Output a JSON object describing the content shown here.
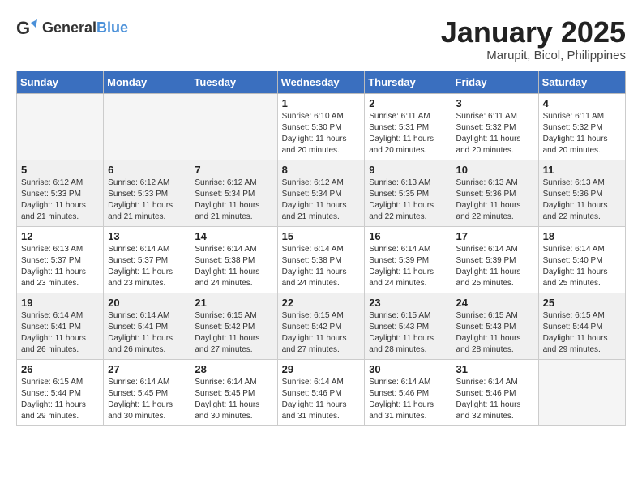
{
  "header": {
    "logo_general": "General",
    "logo_blue": "Blue",
    "month_title": "January 2025",
    "location": "Marupit, Bicol, Philippines"
  },
  "weekdays": [
    "Sunday",
    "Monday",
    "Tuesday",
    "Wednesday",
    "Thursday",
    "Friday",
    "Saturday"
  ],
  "weeks": [
    [
      {
        "day": "",
        "info": ""
      },
      {
        "day": "",
        "info": ""
      },
      {
        "day": "",
        "info": ""
      },
      {
        "day": "1",
        "info": "Sunrise: 6:10 AM\nSunset: 5:30 PM\nDaylight: 11 hours\nand 20 minutes."
      },
      {
        "day": "2",
        "info": "Sunrise: 6:11 AM\nSunset: 5:31 PM\nDaylight: 11 hours\nand 20 minutes."
      },
      {
        "day": "3",
        "info": "Sunrise: 6:11 AM\nSunset: 5:32 PM\nDaylight: 11 hours\nand 20 minutes."
      },
      {
        "day": "4",
        "info": "Sunrise: 6:11 AM\nSunset: 5:32 PM\nDaylight: 11 hours\nand 20 minutes."
      }
    ],
    [
      {
        "day": "5",
        "info": "Sunrise: 6:12 AM\nSunset: 5:33 PM\nDaylight: 11 hours\nand 21 minutes."
      },
      {
        "day": "6",
        "info": "Sunrise: 6:12 AM\nSunset: 5:33 PM\nDaylight: 11 hours\nand 21 minutes."
      },
      {
        "day": "7",
        "info": "Sunrise: 6:12 AM\nSunset: 5:34 PM\nDaylight: 11 hours\nand 21 minutes."
      },
      {
        "day": "8",
        "info": "Sunrise: 6:12 AM\nSunset: 5:34 PM\nDaylight: 11 hours\nand 21 minutes."
      },
      {
        "day": "9",
        "info": "Sunrise: 6:13 AM\nSunset: 5:35 PM\nDaylight: 11 hours\nand 22 minutes."
      },
      {
        "day": "10",
        "info": "Sunrise: 6:13 AM\nSunset: 5:36 PM\nDaylight: 11 hours\nand 22 minutes."
      },
      {
        "day": "11",
        "info": "Sunrise: 6:13 AM\nSunset: 5:36 PM\nDaylight: 11 hours\nand 22 minutes."
      }
    ],
    [
      {
        "day": "12",
        "info": "Sunrise: 6:13 AM\nSunset: 5:37 PM\nDaylight: 11 hours\nand 23 minutes."
      },
      {
        "day": "13",
        "info": "Sunrise: 6:14 AM\nSunset: 5:37 PM\nDaylight: 11 hours\nand 23 minutes."
      },
      {
        "day": "14",
        "info": "Sunrise: 6:14 AM\nSunset: 5:38 PM\nDaylight: 11 hours\nand 24 minutes."
      },
      {
        "day": "15",
        "info": "Sunrise: 6:14 AM\nSunset: 5:38 PM\nDaylight: 11 hours\nand 24 minutes."
      },
      {
        "day": "16",
        "info": "Sunrise: 6:14 AM\nSunset: 5:39 PM\nDaylight: 11 hours\nand 24 minutes."
      },
      {
        "day": "17",
        "info": "Sunrise: 6:14 AM\nSunset: 5:39 PM\nDaylight: 11 hours\nand 25 minutes."
      },
      {
        "day": "18",
        "info": "Sunrise: 6:14 AM\nSunset: 5:40 PM\nDaylight: 11 hours\nand 25 minutes."
      }
    ],
    [
      {
        "day": "19",
        "info": "Sunrise: 6:14 AM\nSunset: 5:41 PM\nDaylight: 11 hours\nand 26 minutes."
      },
      {
        "day": "20",
        "info": "Sunrise: 6:14 AM\nSunset: 5:41 PM\nDaylight: 11 hours\nand 26 minutes."
      },
      {
        "day": "21",
        "info": "Sunrise: 6:15 AM\nSunset: 5:42 PM\nDaylight: 11 hours\nand 27 minutes."
      },
      {
        "day": "22",
        "info": "Sunrise: 6:15 AM\nSunset: 5:42 PM\nDaylight: 11 hours\nand 27 minutes."
      },
      {
        "day": "23",
        "info": "Sunrise: 6:15 AM\nSunset: 5:43 PM\nDaylight: 11 hours\nand 28 minutes."
      },
      {
        "day": "24",
        "info": "Sunrise: 6:15 AM\nSunset: 5:43 PM\nDaylight: 11 hours\nand 28 minutes."
      },
      {
        "day": "25",
        "info": "Sunrise: 6:15 AM\nSunset: 5:44 PM\nDaylight: 11 hours\nand 29 minutes."
      }
    ],
    [
      {
        "day": "26",
        "info": "Sunrise: 6:15 AM\nSunset: 5:44 PM\nDaylight: 11 hours\nand 29 minutes."
      },
      {
        "day": "27",
        "info": "Sunrise: 6:14 AM\nSunset: 5:45 PM\nDaylight: 11 hours\nand 30 minutes."
      },
      {
        "day": "28",
        "info": "Sunrise: 6:14 AM\nSunset: 5:45 PM\nDaylight: 11 hours\nand 30 minutes."
      },
      {
        "day": "29",
        "info": "Sunrise: 6:14 AM\nSunset: 5:46 PM\nDaylight: 11 hours\nand 31 minutes."
      },
      {
        "day": "30",
        "info": "Sunrise: 6:14 AM\nSunset: 5:46 PM\nDaylight: 11 hours\nand 31 minutes."
      },
      {
        "day": "31",
        "info": "Sunrise: 6:14 AM\nSunset: 5:46 PM\nDaylight: 11 hours\nand 32 minutes."
      },
      {
        "day": "",
        "info": ""
      }
    ]
  ]
}
